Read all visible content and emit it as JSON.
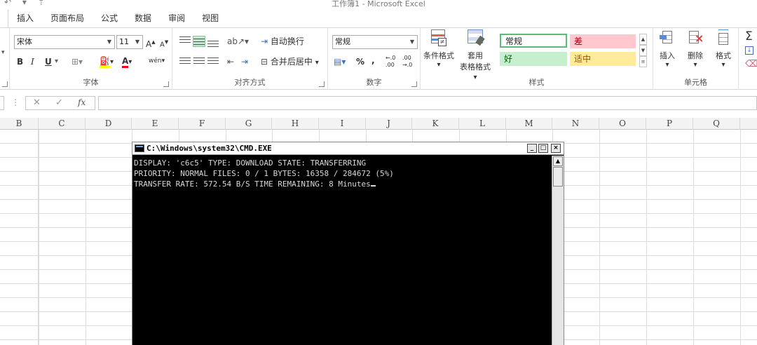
{
  "window": {
    "title": "工作簿1 - Microsoft Excel",
    "qat": "↶ ▾ ⇡"
  },
  "tabs": [
    "插入",
    "页面布局",
    "公式",
    "数据",
    "审阅",
    "视图"
  ],
  "font_group": {
    "font_name": "宋体",
    "font_size": "11",
    "grow": "A",
    "shrink": "A",
    "bold": "B",
    "italic": "I",
    "underline": "U",
    "phonetic": "wén",
    "label": "字体"
  },
  "align_group": {
    "wrap_text": "自动换行",
    "merge_center": "合并后居中",
    "label": "对齐方式"
  },
  "number_group": {
    "format": "常规",
    "percent": "%",
    "comma": ",",
    "inc_decimal": "←.0 .00",
    "dec_decimal": ".00 →.0",
    "label": "数字"
  },
  "styles_group": {
    "conditional_format": "条件格式",
    "table_format_line1": "套用",
    "table_format_line2": "表格格式",
    "normal": "常规",
    "bad": "差",
    "good": "好",
    "neutral": "适中",
    "label": "样式",
    "colors": {
      "normal_border": "#5fb97a",
      "bad_bg": "#ffc7ce",
      "good_bg": "#c6efce",
      "neutral_bg": "#ffeb9c",
      "bad_fg": "#9c0006",
      "good_fg": "#006100",
      "neutral_fg": "#9c5700"
    }
  },
  "cells_group": {
    "insert": "插入",
    "delete": "删除",
    "format": "格式",
    "label": "单元格"
  },
  "formula_bar": {
    "cancel": "✕",
    "enter": "✓",
    "fx": "fx"
  },
  "columns": [
    "B",
    "C",
    "D",
    "E",
    "F",
    "G",
    "H",
    "I",
    "J",
    "K",
    "L",
    "M",
    "N",
    "O",
    "P",
    "Q"
  ],
  "cmd": {
    "title": "C:\\Windows\\system32\\CMD.EXE",
    "minimize": "_",
    "maximize": "□",
    "close": "×",
    "lines": [
      "DISPLAY: 'c6c5' TYPE: DOWNLOAD STATE: TRANSFERRING",
      "PRIORITY: NORMAL FILES: 0 / 1 BYTES: 16358 / 284672 (5%)",
      "TRANSFER RATE: 572.54 B/S TIME REMAINING: 8 Minutes"
    ]
  }
}
